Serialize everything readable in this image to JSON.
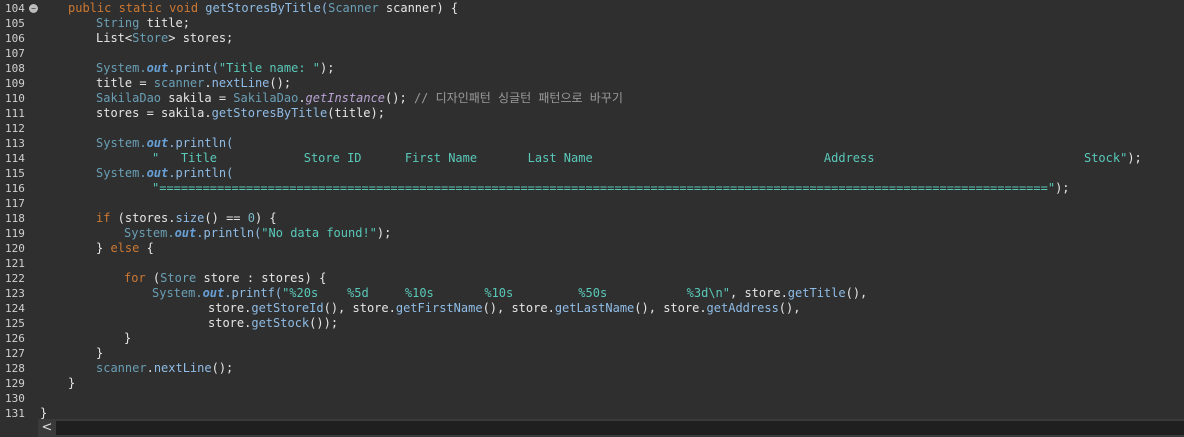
{
  "gutter": {
    "line_numbers": [
      "104",
      "105",
      "106",
      "107",
      "108",
      "109",
      "110",
      "111",
      "112",
      "113",
      "114",
      "115",
      "116",
      "117",
      "118",
      "119",
      "120",
      "121",
      "122",
      "123",
      "124",
      "125",
      "126",
      "127",
      "128",
      "129",
      "130",
      "131"
    ],
    "fold_marker_line": "104",
    "fold_glyph": "−"
  },
  "code": {
    "l104": [
      "public static void ",
      "getStoresByTitle(",
      "Scanner",
      " scanner) {"
    ],
    "l105": [
      "String",
      " title;"
    ],
    "l106": [
      "List<",
      "Store",
      "> stores;"
    ],
    "l108": [
      "System.",
      "out",
      ".print(",
      "\"Title name: \"",
      ");"
    ],
    "l109": [
      "title = ",
      "scanner",
      ".",
      "nextLine",
      "();"
    ],
    "l110": [
      "SakilaDao",
      " sakila = ",
      "SakilaDao",
      ".",
      "getInstance",
      "(); ",
      "// 디자인패턴 싱글턴 패턴으로 바꾸기"
    ],
    "l111": [
      "stores = sakila.",
      "getStoresByTitle",
      "(title);"
    ],
    "l113": [
      "System.",
      "out",
      ".println("
    ],
    "l114": [
      "\"   Title            Store ID      First Name       Last Name                                Address                             Stock\"",
      ");"
    ],
    "l115": [
      "System.",
      "out",
      ".println("
    ],
    "l116": [
      "\"===========================================================================================================================\"",
      ");"
    ],
    "l118": [
      "if",
      " (stores.",
      "size",
      "() == ",
      "0",
      ") {"
    ],
    "l119": [
      "System.",
      "out",
      ".println(",
      "\"No data found!\"",
      ");"
    ],
    "l120": [
      "} ",
      "else",
      " {"
    ],
    "l122": [
      "for",
      " (",
      "Store",
      " store : stores) {"
    ],
    "l123": [
      "System.",
      "out",
      ".printf(",
      "\"%20s    %5d     %10s       %10s         %50s           %3d\\n\"",
      ", store.",
      "getTitle",
      "(),"
    ],
    "l124": [
      "store.",
      "getStoreId",
      "(), store.",
      "getFirstName",
      "(), store.",
      "getLastName",
      "(), store.",
      "getAddress",
      "(),"
    ],
    "l125": [
      "store.",
      "getStock",
      "());"
    ],
    "l126": [
      "}"
    ],
    "l127": [
      "}"
    ],
    "l128": [
      "scanner",
      ".",
      "nextLine",
      "();"
    ],
    "l129": [
      "}"
    ],
    "l131": [
      "}"
    ]
  },
  "scrollbar": {
    "left_arrow": "<"
  }
}
